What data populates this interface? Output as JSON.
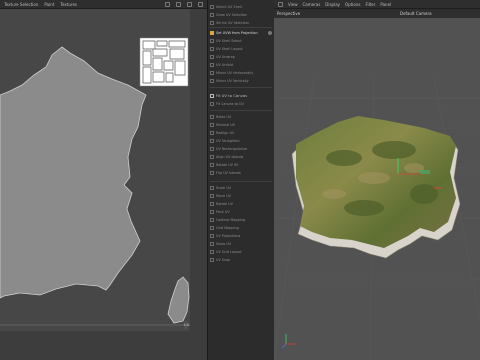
{
  "uv_editor": {
    "menu": [
      "Texture Selection",
      "Paint",
      "Textures"
    ],
    "scale_label": "1.0"
  },
  "tools": {
    "group1": [
      "Select UV Shell",
      "Grow UV Selection",
      "Shrink UV Selection"
    ],
    "projection": "Set UVW from Projection",
    "group2": [
      "UV Shell Select",
      "UV Shell Layout",
      "UV Unwrap",
      "UV Unfold"
    ],
    "group3": [
      "Mirror UV Horizontally",
      "Mirror UV Vertically"
    ],
    "canvas_btn": "Fit UV to Canvas",
    "canvas_sub": "Fit Canvas to UV",
    "group4": [
      "Relax UV",
      "Minimal UV",
      "Realign UV",
      "UV Straighten",
      "UV Rectangularize",
      "Align UV Islands",
      "Rotate UV 90",
      "Flip UV Islands"
    ],
    "group5": [
      "Scale UV",
      "Move UV",
      "Rotate UV",
      "Pack UV",
      "Optimal Mapping",
      "Grid Mapping",
      "UV Projections",
      "Show UV",
      "UV Grid Layout",
      "UV Snap"
    ]
  },
  "viewport": {
    "menu": [
      "View",
      "Cameras",
      "Display",
      "Options",
      "Filter",
      "Panel"
    ],
    "view_name": "Perspective",
    "camera": "Default Camera"
  }
}
